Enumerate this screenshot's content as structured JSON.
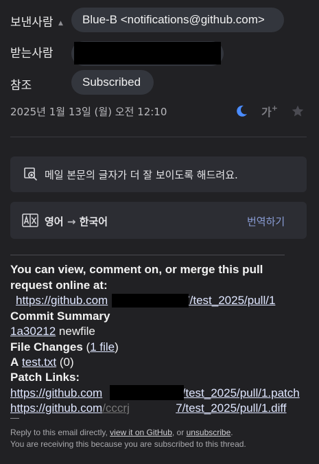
{
  "header": {
    "from_label": "보낸사람",
    "from_value": "Blue-B <notifications@github.com>",
    "to_label": "받는사람",
    "cc_label": "참조",
    "cc_value": "Subscribed",
    "date": "2025년 1월 13일 (월) 오전 12:10",
    "font_toggle": "가",
    "icons": [
      "caret-up-icon",
      "moon-icon",
      "font-size-icon",
      "star-icon"
    ]
  },
  "accessibility_card": {
    "text": "메일 본문의 글자가 더 잘 보이도록 해드려요.",
    "icon": "zoom-text-icon"
  },
  "translate_card": {
    "source": "영어",
    "arrow": "→",
    "target": "한국어",
    "action": "번역하기",
    "icon": "translate-icon"
  },
  "email": {
    "line1": "You can view, comment on, or merge this pull",
    "line2": "request online at:",
    "pr_url_start": "https://github.com",
    "pr_url_end": "7/test_2025/pull/1",
    "commit_summary_label": "Commit Summary",
    "commit_hash": "1a30212",
    "commit_message": "newfile",
    "file_changes_label": "File Changes",
    "file_changes_paren_open": "(",
    "file_changes_link": "1 file",
    "file_changes_paren_close": ")",
    "file_status": "A",
    "file_name": "test.txt",
    "file_count": "(0)",
    "patch_links_label": "Patch Links:",
    "patch_link_start": "https://github.com",
    "patch_link_end": "7/test_2025/pull/1.patch",
    "diff_link_start": "https://github.com",
    "diff_link_mid": "/cccrj",
    "diff_link_end": "7/test_2025/pull/1.diff",
    "dash": "—",
    "footer_reply_prefix": "Reply to this email directly,",
    "footer_view_link": "view it on GitHub",
    "footer_or": ", or",
    "footer_unsubscribe": "unsubscribe",
    "footer_period": ".",
    "footer_line2": "You are receiving this because you are subscribed to this thread."
  },
  "colors": {
    "background": "#212124",
    "chip": "#33363d",
    "accent_moon": "#4a8cff",
    "action_link": "#8a9dd6"
  }
}
